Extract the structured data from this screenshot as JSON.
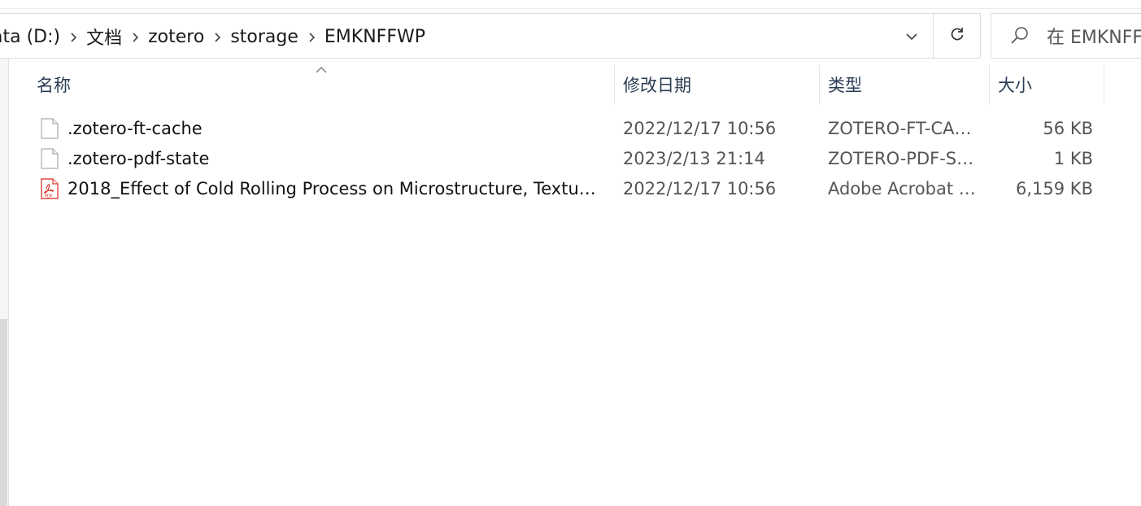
{
  "address_bar": {
    "breadcrumbs": [
      "ata (D:)",
      "文档",
      "zotero",
      "storage",
      "EMKNFFWP"
    ]
  },
  "search": {
    "placeholder": "在 EMKNFFWP 中搜索",
    "visible_text": "在 EMKNFF"
  },
  "columns": {
    "name": "名称",
    "date_modified": "修改日期",
    "type": "类型",
    "size": "大小"
  },
  "files": [
    {
      "name": ".zotero-ft-cache",
      "date_modified": "2022/12/17 10:56",
      "type": "ZOTERO-FT-CA…",
      "size": "56 KB",
      "icon": "blank-file-icon"
    },
    {
      "name": ".zotero-pdf-state",
      "date_modified": "2023/2/13 21:14",
      "type": "ZOTERO-PDF-S…",
      "size": "1 KB",
      "icon": "blank-file-icon"
    },
    {
      "name": "2018_Effect of Cold Rolling Process on Microstructure, Textu…",
      "date_modified": "2022/12/17 10:56",
      "type": "Adobe Acrobat …",
      "size": "6,159 KB",
      "icon": "pdf-file-icon"
    }
  ],
  "colors": {
    "header_text": "#2b3d54",
    "pdf_red": "#d9241b",
    "border": "#dcdcdc"
  }
}
